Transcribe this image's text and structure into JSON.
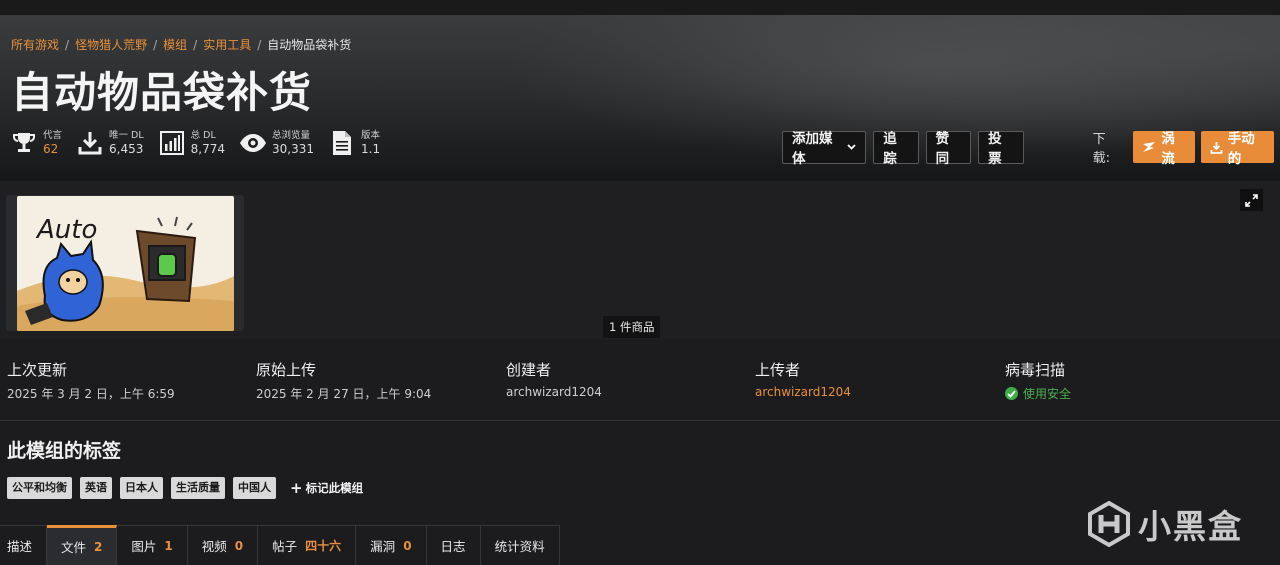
{
  "breadcrumb": {
    "items": [
      "所有游戏",
      "怪物猎人荒野",
      "模组",
      "实用工具"
    ],
    "current": "自动物品袋补货"
  },
  "title": "自动物品袋补货",
  "stats": {
    "endorsements": {
      "label": "代言",
      "value": "62",
      "icon": "trophy-icon"
    },
    "unique_dl": {
      "label": "唯一 DL",
      "value": "6,453",
      "icon": "download-icon"
    },
    "total_dl": {
      "label": "总 DL",
      "value": "8,774",
      "icon": "bar-chart-icon"
    },
    "total_views": {
      "label": "总浏览量",
      "value": "30,331",
      "icon": "eye-icon"
    },
    "version": {
      "label": "版本",
      "value": "1.1",
      "icon": "document-icon"
    }
  },
  "actions": {
    "add_media": "添加媒体",
    "track": "追踪",
    "endorse": "赞同",
    "vote": "投票",
    "download_label": "下载:",
    "vortex": "涡流",
    "manual": "手动的"
  },
  "media": {
    "count": "1 件商品",
    "thumbnail_text": "Auto"
  },
  "meta": {
    "last_updated": {
      "heading": "上次更新",
      "value": "2025 年 3 月 2 日，上午 6:59"
    },
    "original_upload": {
      "heading": "原始上传",
      "value": "2025 年 2 月 27 日，上午 9:04"
    },
    "creator": {
      "heading": "创建者",
      "value": "archwizard1204"
    },
    "uploader": {
      "heading": "上传者",
      "value": "archwizard1204"
    },
    "virus_scan": {
      "heading": "病毒扫描",
      "value": "使用安全"
    }
  },
  "tags": {
    "title": "此模组的标签",
    "items": [
      "公平和均衡",
      "英语",
      "日本人",
      "生活质量",
      "中国人"
    ],
    "tag_this_mod": "标记此模组"
  },
  "tabs": [
    {
      "label": "描述",
      "count": ""
    },
    {
      "label": "文件",
      "count": "2"
    },
    {
      "label": "图片",
      "count": "1"
    },
    {
      "label": "视频",
      "count": "0"
    },
    {
      "label": "帖子",
      "count": "四十六"
    },
    {
      "label": "漏洞",
      "count": "0"
    },
    {
      "label": "日志",
      "count": ""
    },
    {
      "label": "统计资料",
      "count": ""
    }
  ],
  "watermark": {
    "text": "小黑盒"
  },
  "colors": {
    "accent": "#e8913a",
    "background": "#1c1c1f",
    "safe": "#3fae4a"
  }
}
